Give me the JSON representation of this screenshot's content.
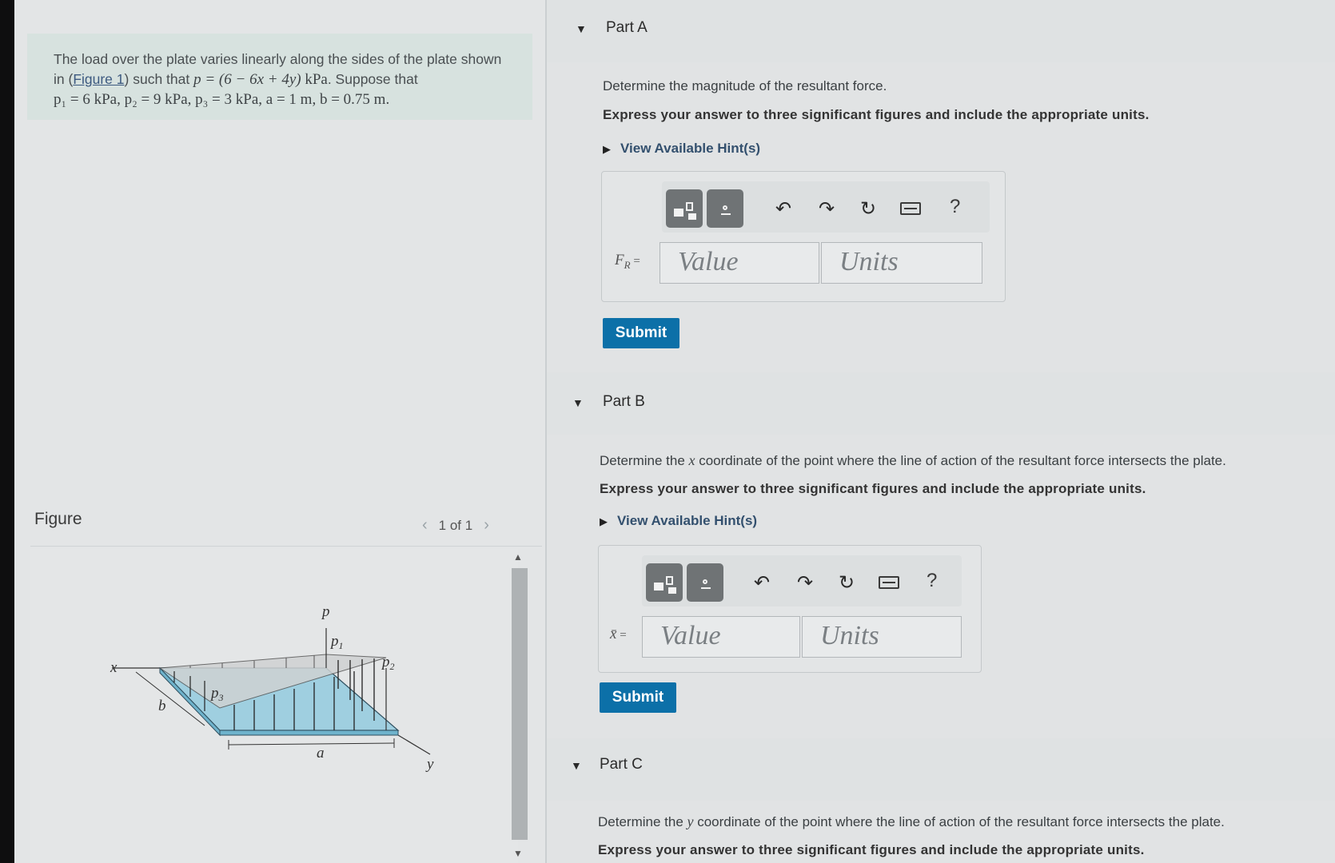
{
  "problem": {
    "line1": "The load over the plate varies linearly along the sides of the plate shown",
    "line2_pre": "in (",
    "figure_link": "Figure 1",
    "line2_mid": ") such that ",
    "line2_eq": "p = (6 − 6x + 4y)",
    "line2_unit": " kPa",
    "line2_post": ". Suppose that",
    "line3": "p₁ = 6 kPa, p₂ = 9 kPa, p₃ = 3 kPa, a = 1 m, b = 0.75 m."
  },
  "figure": {
    "label": "Figure",
    "pager": "1 of 1",
    "prev_icon": "chevron-left-icon",
    "next_icon": "chevron-right-icon",
    "diagram_labels": {
      "p": "p",
      "p1": "p",
      "p1_sub": "1",
      "p2": "p",
      "p2_sub": "2",
      "p3": "p",
      "p3_sub": "3",
      "x": "x",
      "y": "y",
      "a": "a",
      "b": "b"
    }
  },
  "parts": {
    "a": {
      "title": "Part A",
      "question": "Determine the magnitude of the resultant force.",
      "instruction": "Express your answer to three significant figures and include the appropriate units.",
      "hints": "View Available Hint(s)",
      "eq_label": "F",
      "eq_sub": "R",
      "eq_suffix": " =",
      "value_placeholder": "Value",
      "units_placeholder": "Units",
      "submit": "Submit"
    },
    "b": {
      "title": "Part B",
      "question_pre": "Determine the ",
      "question_var": "x",
      "question_post": " coordinate of the point where the line of action of the resultant force intersects the plate.",
      "instruction": "Express your answer to three significant figures and include the appropriate units.",
      "hints": "View Available Hint(s)",
      "eq_label": "x̄",
      "eq_suffix": " =",
      "value_placeholder": "Value",
      "units_placeholder": "Units",
      "submit": "Submit"
    },
    "c": {
      "title": "Part C",
      "question_pre": "Determine the ",
      "question_var": "y",
      "question_post": " coordinate of the point where the line of action of the resultant force intersects the plate.",
      "instruction": "Express your answer to three significant figures and include the appropriate units."
    }
  },
  "toolbar": {
    "help": "?",
    "icons": [
      "templates-icon",
      "symbols-icon",
      "undo-icon",
      "redo-icon",
      "reset-icon",
      "keyboard-icon",
      "help-icon"
    ]
  },
  "colors": {
    "submit_bg": "#0c70a8",
    "problem_bg": "#d7e2df",
    "plate_fill": "#9fcfe0"
  }
}
